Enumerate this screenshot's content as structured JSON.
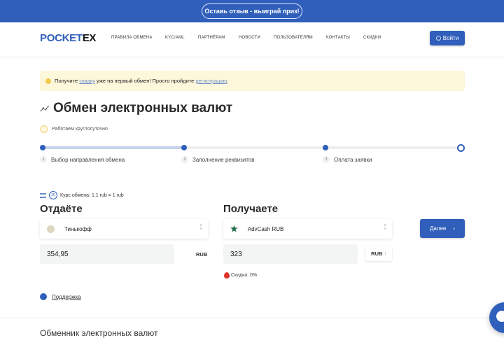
{
  "banner": {
    "label": "Оставь отзыв - выиграй приз!"
  },
  "header": {
    "logo_a": "POCKET",
    "logo_b": "EX",
    "nav": [
      "ПРАВИЛА ОБМЕНА",
      "KYC/AML",
      "ПАРТНЁРАМ",
      "НОВОСТИ",
      "ПОЛЬЗОВАТЕЛЯМ",
      "КОНТАКТЫ",
      "СКИДКИ"
    ],
    "login": "Войти"
  },
  "alert": {
    "t1": "Получите ",
    "link1": "скидку",
    "t2": " уже на первый обмен! Просто пройдите ",
    "link2": "регистрацию",
    "t3": "."
  },
  "title": "Обмен электронных валют",
  "hours": "Работаем круглосуточно",
  "progress": {
    "current_step": 1,
    "steps": [
      {
        "num": "1",
        "label": "Выбор направления обмена"
      },
      {
        "num": "2",
        "label": "Заполнение реквизитов"
      },
      {
        "num": "3",
        "label": "Оплата заявки"
      }
    ]
  },
  "rate": {
    "timer": "26",
    "text": "Курс обмена: 1.1 rub = 1 rub"
  },
  "give": {
    "heading": "Отдаёте",
    "currency": "Тинькофф",
    "amount": "354,95",
    "unit": "RUB"
  },
  "get": {
    "heading": "Получаете",
    "currency": "AdvCash RUB",
    "amount": "323",
    "unit": "RUB",
    "discount": "Скидка: 0%"
  },
  "next": "Далее",
  "support": "Поддержка",
  "footer_title": "Обменник электронных валют"
}
